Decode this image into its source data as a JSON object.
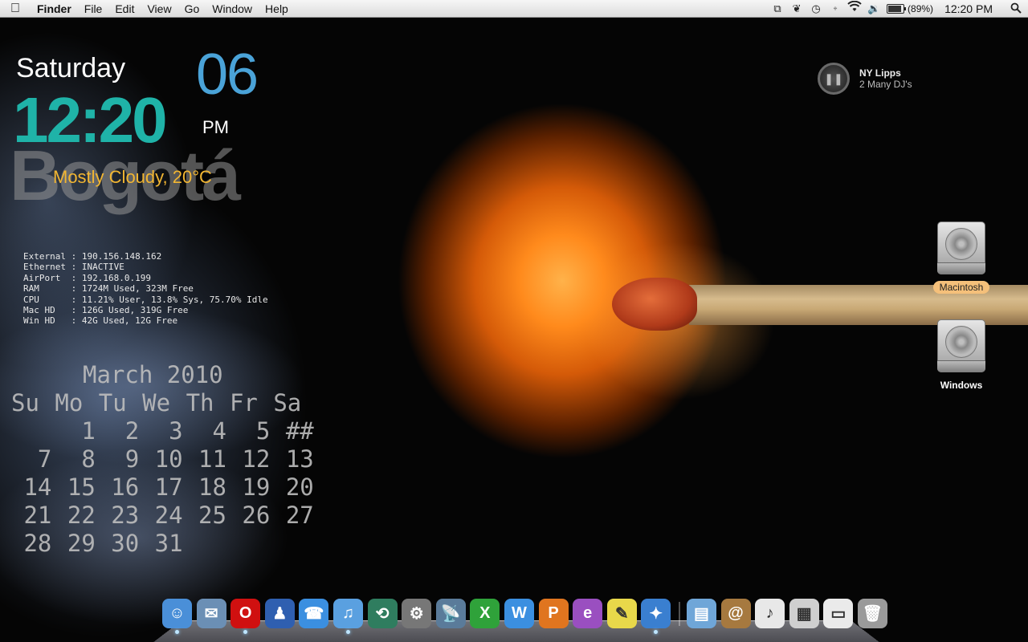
{
  "menubar": {
    "apple_icon": "apple-logo-icon",
    "app_name": "Finder",
    "menus": [
      "File",
      "Edit",
      "View",
      "Go",
      "Window",
      "Help"
    ],
    "status_icons": [
      "spaces-icon",
      "butterfly-icon",
      "time-machine-icon",
      "bluetooth-icon",
      "wifi-icon",
      "volume-icon"
    ],
    "battery_percent_label": "(89%)",
    "battery_level": 0.89,
    "clock": "12:20 PM",
    "spotlight_icon": "spotlight-search-icon"
  },
  "clock_widget": {
    "day_name": "Saturday",
    "time": "12:20",
    "date_number": "06",
    "ampm": "PM",
    "city": "Bogotá",
    "weather": "Mostly Cloudy, 20°C",
    "colors": {
      "time": "#1fb3a8",
      "date": "#4aa3d8",
      "weather": "#f2b632"
    }
  },
  "system_info": [
    {
      "label": "External",
      "value": "190.156.148.162"
    },
    {
      "label": "Ethernet",
      "value": "INACTIVE"
    },
    {
      "label": "AirPort ",
      "value": "192.168.0.199"
    },
    {
      "label": "RAM     ",
      "value": "1724M Used, 323M Free"
    },
    {
      "label": "CPU     ",
      "value": "11.21% User, 13.8% Sys, 75.70% Idle"
    },
    {
      "label": "Mac HD  ",
      "value": "126G Used, 319G Free"
    },
    {
      "label": "Win HD  ",
      "value": "42G Used, 12G Free"
    }
  ],
  "calendar": {
    "title": "March 2010",
    "weekdays": [
      "Su",
      "Mo",
      "Tu",
      "We",
      "Th",
      "Fr",
      "Sa"
    ],
    "weeks": [
      [
        "",
        "1",
        "2",
        "3",
        "4",
        "5",
        "##"
      ],
      [
        "7",
        "8",
        "9",
        "10",
        "11",
        "12",
        "13"
      ],
      [
        "14",
        "15",
        "16",
        "17",
        "18",
        "19",
        "20"
      ],
      [
        "21",
        "22",
        "23",
        "24",
        "25",
        "26",
        "27"
      ],
      [
        "28",
        "29",
        "30",
        "31",
        "",
        "",
        ""
      ]
    ]
  },
  "now_playing": {
    "title": "NY Lipps",
    "artist": "2 Many DJ's",
    "button_icon": "pause-icon"
  },
  "desktop_icons": [
    {
      "label": "Macintosh",
      "icon": "hard-drive-icon",
      "selected": true
    },
    {
      "label": "Windows",
      "icon": "hard-drive-icon",
      "selected": false
    }
  ],
  "dock": {
    "apps": [
      {
        "name": "finder-icon",
        "glyph": "☺",
        "bg": "#4a8fd8",
        "running": true
      },
      {
        "name": "mail-icon",
        "glyph": "✉",
        "bg": "#6b8fb5",
        "running": false
      },
      {
        "name": "opera-icon",
        "glyph": "O",
        "bg": "#d01010",
        "running": true
      },
      {
        "name": "adium-duck-icon",
        "glyph": "♟",
        "bg": "#2f5fb0",
        "running": false
      },
      {
        "name": "ichat-icon",
        "glyph": "☎",
        "bg": "#3b8fe0",
        "running": false
      },
      {
        "name": "itunes-icon",
        "glyph": "♫",
        "bg": "#5aa0e0",
        "running": true
      },
      {
        "name": "time-machine-icon",
        "glyph": "⟲",
        "bg": "#2f7d5f",
        "running": false
      },
      {
        "name": "system-preferences-icon",
        "glyph": "⚙",
        "bg": "#777777",
        "running": false
      },
      {
        "name": "network-icon",
        "glyph": "📡",
        "bg": "#5a7b9a",
        "running": false
      },
      {
        "name": "excel-icon",
        "glyph": "X",
        "bg": "#2fa23a",
        "running": false
      },
      {
        "name": "word-icon",
        "glyph": "W",
        "bg": "#3b8fe0",
        "running": false
      },
      {
        "name": "powerpoint-icon",
        "glyph": "P",
        "bg": "#e0751f",
        "running": false
      },
      {
        "name": "entourage-icon",
        "glyph": "e",
        "bg": "#9a4fc0",
        "running": false
      },
      {
        "name": "stickies-icon",
        "glyph": "✎",
        "bg": "#e8d84a",
        "running": false
      },
      {
        "name": "safari-icon",
        "glyph": "✦",
        "bg": "#3a7fd0",
        "running": true
      }
    ],
    "stacks": [
      {
        "name": "applications-folder-icon",
        "glyph": "▤",
        "bg": "#6fa6d8"
      },
      {
        "name": "address-book-icon",
        "glyph": "@",
        "bg": "#a6793f"
      },
      {
        "name": "theme-document-icon",
        "glyph": "♪",
        "bg": "#e8e8e8"
      },
      {
        "name": "keyboard-viewer-icon",
        "glyph": "▦",
        "bg": "#cfcfcf"
      },
      {
        "name": "screenshot-icon",
        "glyph": "▭",
        "bg": "#eaeaea"
      },
      {
        "name": "trash-icon",
        "glyph": "🗑",
        "bg": "#9a9a9a"
      }
    ]
  }
}
